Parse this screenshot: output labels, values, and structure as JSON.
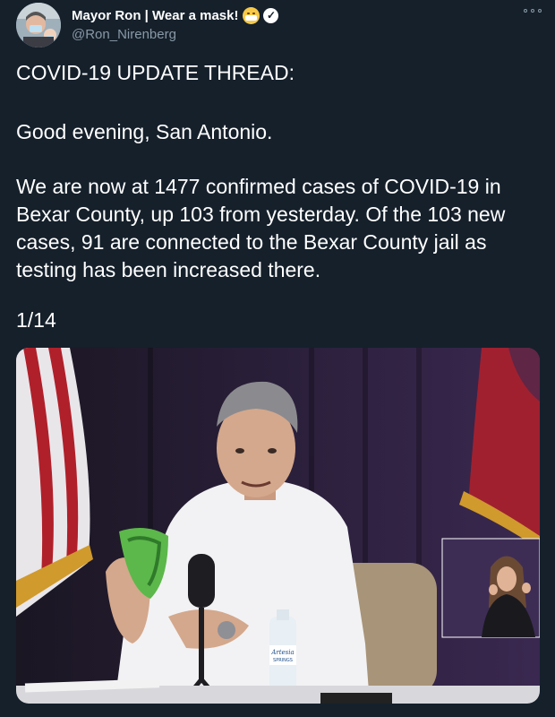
{
  "author": {
    "display_name": "Mayor Ron | Wear a mask!",
    "emoji_icon": "mask-face-emoji-icon",
    "verified_icon": "verified-badge-icon",
    "handle": "@Ron_Nirenberg"
  },
  "tweet": {
    "paragraphs": [
      "COVID-19 UPDATE THREAD:",
      "Good evening, San Antonio.",
      "We are now at 1477 confirmed cases of COVID-19 in Bexar County, up 103 from yesterday. Of the 103 new cases, 91 are connected to the Bexar County jail as testing has been increased there.",
      "1/14"
    ]
  },
  "media": {
    "bottle_label": "Artesia Springs"
  },
  "colors": {
    "background": "#15202b",
    "text": "#ffffff",
    "secondary_text": "#8899a6"
  }
}
